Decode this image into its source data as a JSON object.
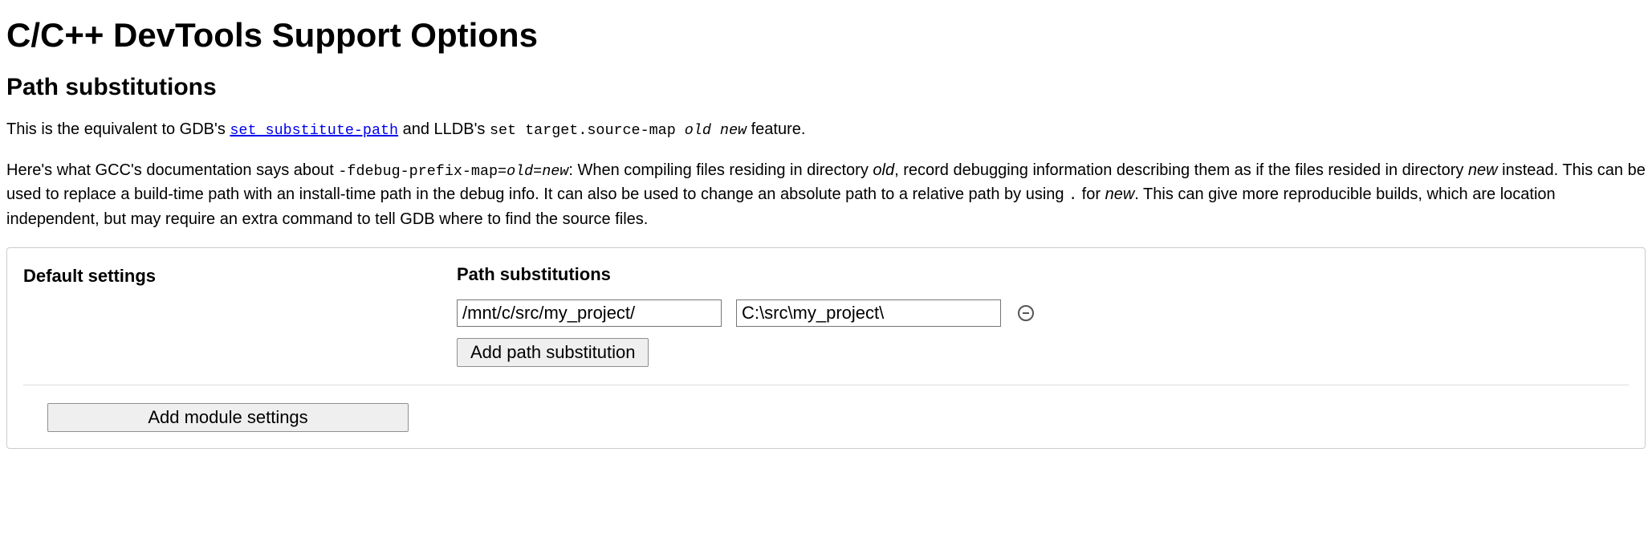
{
  "page": {
    "title": "C/C++ DevTools Support Options",
    "section_heading": "Path substitutions"
  },
  "intro": {
    "p1_prefix": "This is the equivalent to GDB's ",
    "p1_link_text": "set substitute-path",
    "p1_mid": " and LLDB's ",
    "p1_code2": "set target.source-map ",
    "p1_code2_em": "old new",
    "p1_suffix": " feature.",
    "p2_a": "Here's what GCC's documentation says about ",
    "p2_code1": "-fdebug-prefix-map=",
    "p2_code1_em": "old=new",
    "p2_b": ": When compiling files residing in directory ",
    "p2_em_old": "old",
    "p2_c": ", record debugging information describing them as if the files resided in directory ",
    "p2_em_new": "new",
    "p2_d": " instead. This can be used to replace a build-time path with an install-time path in the debug info. It can also be used to change an absolute path to a relative path by using ",
    "p2_dot": ".",
    "p2_e": " for ",
    "p2_em_new2": "new",
    "p2_f": ". This can give more reproducible builds, which are location independent, but may require an extra command to tell GDB where to find the source files."
  },
  "panel": {
    "default_settings_label": "Default settings",
    "path_sub_label": "Path substitutions",
    "rows": [
      {
        "from": "/mnt/c/src/my_project/",
        "to": "C:\\src\\my_project\\"
      }
    ],
    "add_path_button": "Add path substitution",
    "add_module_button": "Add module settings"
  }
}
